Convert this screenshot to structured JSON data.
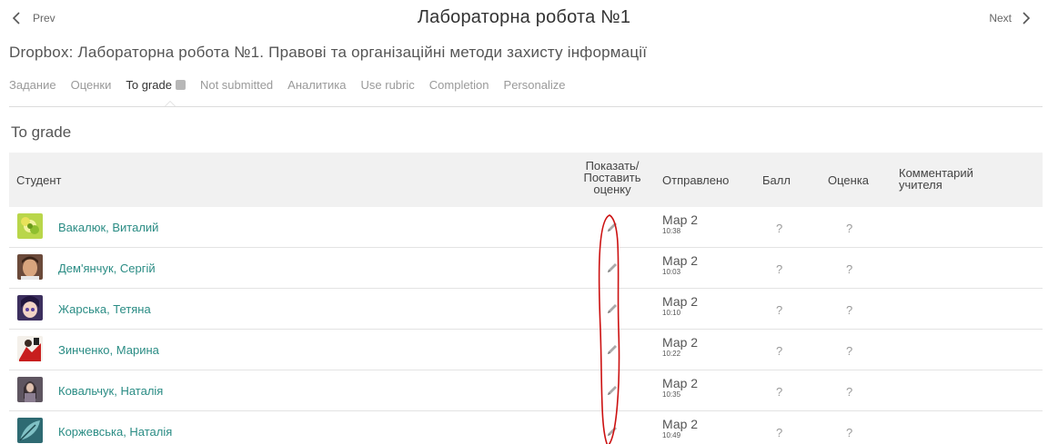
{
  "nav": {
    "prev_label": "Prev",
    "next_label": "Next",
    "title": "Лабораторна робота №1"
  },
  "subtitle": "Dropbox: Лабораторна робота №1. Правові та організаційні методи захисту інформації",
  "tabs": [
    {
      "label": "Задание",
      "active": false
    },
    {
      "label": "Оценки",
      "active": false
    },
    {
      "label": "To grade",
      "active": true,
      "badge": true
    },
    {
      "label": "Not submitted",
      "active": false
    },
    {
      "label": "Аналитика",
      "active": false
    },
    {
      "label": "Use rubric",
      "active": false
    },
    {
      "label": "Completion",
      "active": false
    },
    {
      "label": "Personalize",
      "active": false
    }
  ],
  "section_title": "To grade",
  "table": {
    "headers": {
      "student": "Студент",
      "show_line1": "Показать/",
      "show_line2": "Поставить",
      "show_line3": "оценку",
      "sent": "Отправлено",
      "score": "Балл",
      "grade": "Оценка",
      "comment_line1": "Комментарий",
      "comment_line2": "учителя"
    },
    "rows": [
      {
        "name": "Вакалюк, Виталий",
        "date": "Мар 2",
        "time": "10:38",
        "score": "?",
        "grade": "?",
        "avatar": "flower"
      },
      {
        "name": "Дем'янчук, Сергій",
        "date": "Мар 2",
        "time": "10:03",
        "score": "?",
        "grade": "?",
        "avatar": "man"
      },
      {
        "name": "Жарська, Тетяна",
        "date": "Мар 2",
        "time": "10:10",
        "score": "?",
        "grade": "?",
        "avatar": "anime"
      },
      {
        "name": "Зинченко, Марина",
        "date": "Мар 2",
        "time": "10:22",
        "score": "?",
        "grade": "?",
        "avatar": "red"
      },
      {
        "name": "Ковальчук, Наталія",
        "date": "Мар 2",
        "time": "10:35",
        "score": "?",
        "grade": "?",
        "avatar": "woman"
      },
      {
        "name": "Коржевська, Наталія",
        "date": "Мар 2",
        "time": "10:49",
        "score": "?",
        "grade": "?",
        "avatar": "leaf"
      }
    ]
  },
  "colors": {
    "link": "#2a8c84",
    "header_bg": "#f1f1f1",
    "annotation": "#cc1111"
  }
}
